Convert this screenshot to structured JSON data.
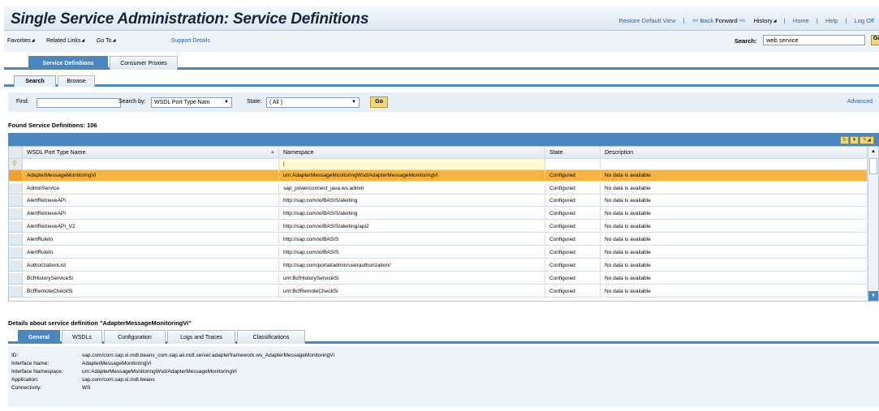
{
  "header": {
    "title": "Single Service Administration: Service Definitions",
    "restore": "Restore Default View",
    "back": "Back",
    "forward": "Forward",
    "history": "History",
    "home": "Home",
    "help": "Help",
    "logoff": "Log Off"
  },
  "favbar": {
    "favorites": "Favorites",
    "related": "Related Links",
    "goto": "Go To",
    "support": "Support Details",
    "search_label": "Search:",
    "search_value": "web service",
    "go": "Go"
  },
  "tabs": [
    "Service Definitions",
    "Consumer Proxies"
  ],
  "subtabs": [
    "Search",
    "Browse"
  ],
  "form": {
    "find_label": "Find:",
    "searchby_label": "Search by:",
    "searchby_value": "WSDL Port Type Nam",
    "state_label": "State:",
    "state_value": "( All )",
    "go": "Go",
    "advanced": "Advanced"
  },
  "found": "Found Service Definitions: 106",
  "table": {
    "columns": [
      "WSDL Port Type Name",
      "Namespace",
      "State",
      "Description"
    ],
    "rows": [
      [
        "AdapterMessageMonitoringVi",
        "urn:AdapterMessageMonitoringWsd/AdapterMessageMonitoringVi",
        "Configured",
        "No data is available"
      ],
      [
        "AdminService",
        "sap_powerconnect_java.ws.admin",
        "Configured",
        "No data is available"
      ],
      [
        "AlertRetrieveAPI",
        "http://sap.com/xi/BASIS/alerting",
        "Configured",
        "No data is available"
      ],
      [
        "AlertRetrieveAPI",
        "http://sap.com/xi/BASIS/alerting",
        "Configured",
        "No data is available"
      ],
      [
        "AlertRetrieveAPI_V2",
        "http://sap.com/xi/BASIS/alerting/api2",
        "Configured",
        "No data is available"
      ],
      [
        "AlertRuleIn",
        "http://sap.com/xi/BASIS",
        "Configured",
        "No data is available"
      ],
      [
        "AlertRuleIn",
        "http://sap.com/xi/BASIS",
        "Configured",
        "No data is available"
      ],
      [
        "AuthorizationList",
        "http://sap.com/portal/admin/userauthorization/",
        "Configured",
        "No data is available"
      ],
      [
        "BcfHistoryServiceSi",
        "urn:BcfHistoryServiceSi",
        "Configured",
        "No data is available"
      ],
      [
        "BcfRemoteCheckSi",
        "urn:BcfRemoteCheckSi",
        "Configured",
        "No data is available"
      ]
    ]
  },
  "details": {
    "title": "Details about service definition \"AdapterMessageMonitoringVi\"",
    "tabs": [
      "General",
      "WSDLs",
      "Configuration",
      "Logs and Traces",
      "Classifications"
    ],
    "fields": [
      {
        "label": "ID:",
        "value": "sap.com/com.sap.xi.mdt.beans_com.sap.aii.mdt.server.adapterframework.ws_AdapterMessageMonitoringVi"
      },
      {
        "label": "Interface Name:",
        "value": "AdapterMessageMonitoringVi"
      },
      {
        "label": "Interface Namespace:",
        "value": "urn:AdapterMessageMonitoringWsd/AdapterMessageMonitoringVi"
      },
      {
        "label": "Application:",
        "value": "sap.com/com.sap.xi.mdt.beans"
      },
      {
        "label": "Connectivity:",
        "value": "WS"
      }
    ]
  }
}
